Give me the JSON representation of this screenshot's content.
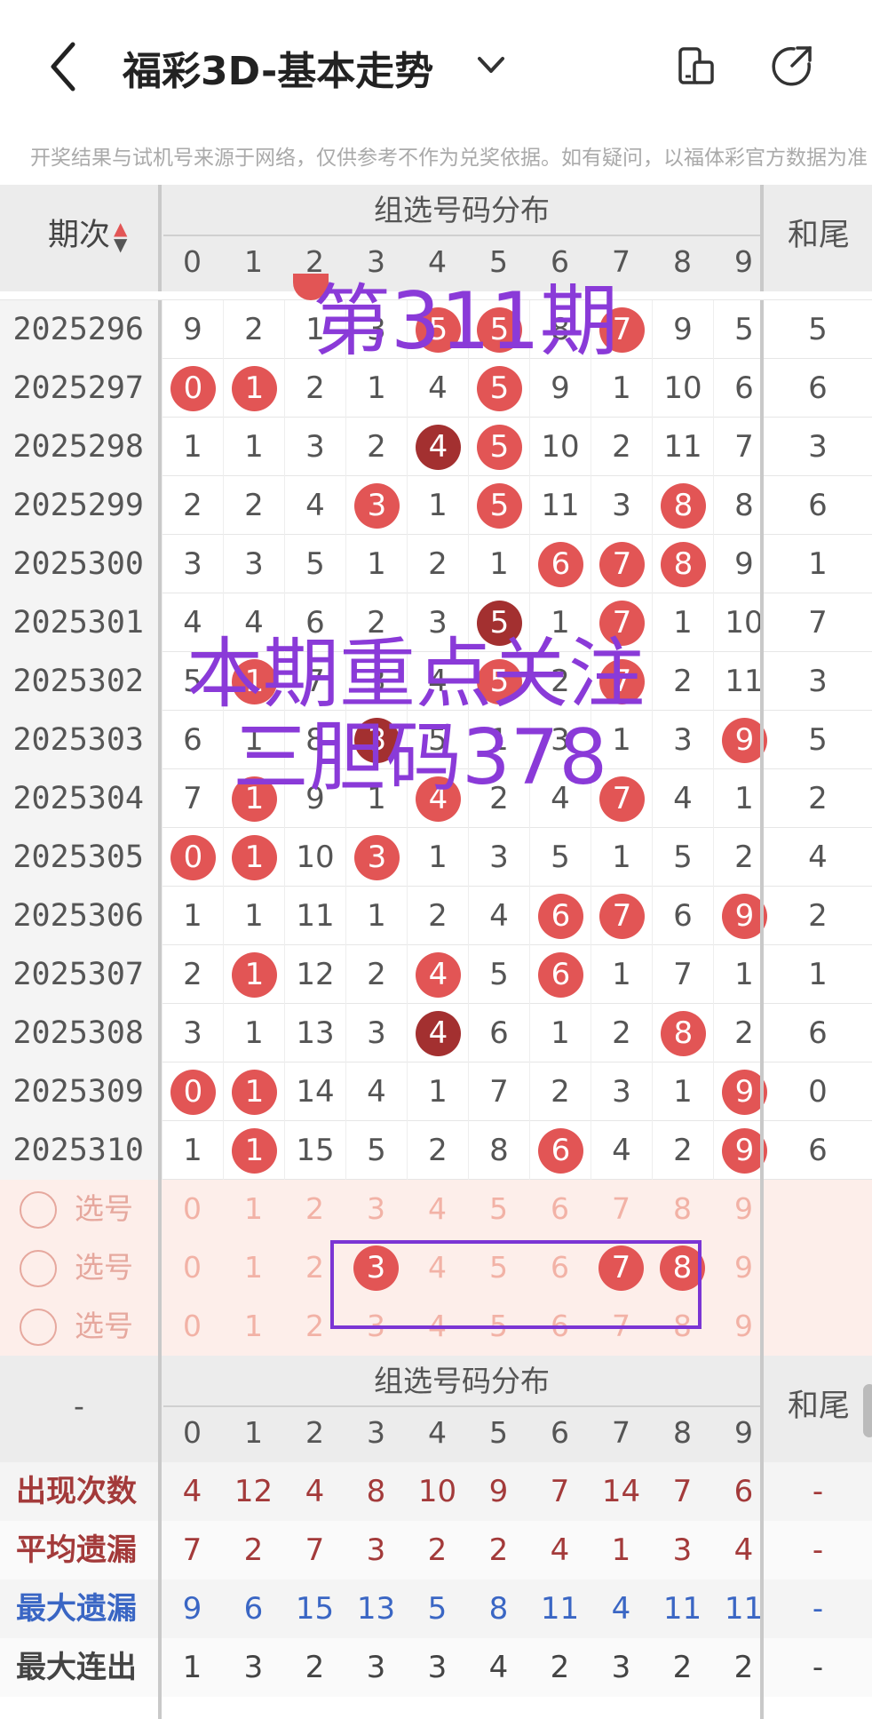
{
  "header": {
    "title": "福彩3D-基本走势",
    "back_icon": "chevron-left-icon",
    "dropdown_icon": "chevron-down-icon",
    "split_icon": "split-screen-icon",
    "share_icon": "share-icon"
  },
  "notice": "开奖结果与试机号来源于网络，仅供参考不作为兑奖依据。如有疑问，以福体彩官方数据为准",
  "table": {
    "period_header": "期次",
    "group_header": "组选号码分布",
    "tail_header": "和尾",
    "digits": [
      "0",
      "1",
      "2",
      "3",
      "4",
      "5",
      "6",
      "7",
      "8",
      "9"
    ],
    "rows": [
      {
        "period": "2025296",
        "cells": [
          "9",
          "2",
          "1",
          "3",
          "5",
          "5",
          "8",
          "7",
          "9",
          "5"
        ],
        "balls": [
          4,
          5,
          7
        ],
        "dark": [],
        "tail": "5"
      },
      {
        "period": "2025297",
        "cells": [
          "0",
          "1",
          "2",
          "1",
          "4",
          "5",
          "9",
          "1",
          "10",
          "6"
        ],
        "balls": [
          0,
          1,
          5
        ],
        "dark": [],
        "tail": "6"
      },
      {
        "period": "2025298",
        "cells": [
          "1",
          "1",
          "3",
          "2",
          "4",
          "5",
          "10",
          "2",
          "11",
          "7"
        ],
        "balls": [
          4,
          5
        ],
        "dark": [
          4
        ],
        "tail": "3"
      },
      {
        "period": "2025299",
        "cells": [
          "2",
          "2",
          "4",
          "3",
          "1",
          "5",
          "11",
          "3",
          "8",
          "8"
        ],
        "balls": [
          3,
          5,
          8
        ],
        "dark": [],
        "tail": "6"
      },
      {
        "period": "2025300",
        "cells": [
          "3",
          "3",
          "5",
          "1",
          "2",
          "1",
          "6",
          "7",
          "8",
          "9"
        ],
        "balls": [
          6,
          7,
          8
        ],
        "dark": [],
        "tail": "1"
      },
      {
        "period": "2025301",
        "cells": [
          "4",
          "4",
          "6",
          "2",
          "3",
          "5",
          "1",
          "7",
          "1",
          "10"
        ],
        "balls": [
          5,
          7
        ],
        "dark": [
          5
        ],
        "tail": "7"
      },
      {
        "period": "2025302",
        "cells": [
          "5",
          "1",
          "7",
          "3",
          "4",
          "5",
          "2",
          "7",
          "2",
          "11"
        ],
        "balls": [
          1,
          5,
          7
        ],
        "dark": [],
        "tail": "3"
      },
      {
        "period": "2025303",
        "cells": [
          "6",
          "1",
          "8",
          "3",
          "5",
          "1",
          "3",
          "1",
          "3",
          "9"
        ],
        "balls": [
          3,
          9
        ],
        "dark": [
          3
        ],
        "tail": "5"
      },
      {
        "period": "2025304",
        "cells": [
          "7",
          "1",
          "9",
          "1",
          "4",
          "2",
          "4",
          "7",
          "4",
          "1"
        ],
        "balls": [
          1,
          4,
          7
        ],
        "dark": [],
        "tail": "2"
      },
      {
        "period": "2025305",
        "cells": [
          "0",
          "1",
          "10",
          "3",
          "1",
          "3",
          "5",
          "1",
          "5",
          "2"
        ],
        "balls": [
          0,
          1,
          3
        ],
        "dark": [],
        "tail": "4"
      },
      {
        "period": "2025306",
        "cells": [
          "1",
          "1",
          "11",
          "1",
          "2",
          "4",
          "6",
          "7",
          "6",
          "9"
        ],
        "balls": [
          6,
          7,
          9
        ],
        "dark": [],
        "tail": "2"
      },
      {
        "period": "2025307",
        "cells": [
          "2",
          "1",
          "12",
          "2",
          "4",
          "5",
          "6",
          "1",
          "7",
          "1"
        ],
        "balls": [
          1,
          4,
          6
        ],
        "dark": [],
        "tail": "1"
      },
      {
        "period": "2025308",
        "cells": [
          "3",
          "1",
          "13",
          "3",
          "4",
          "6",
          "1",
          "2",
          "8",
          "2"
        ],
        "balls": [
          4,
          8
        ],
        "dark": [
          4
        ],
        "tail": "6"
      },
      {
        "period": "2025309",
        "cells": [
          "0",
          "1",
          "14",
          "4",
          "1",
          "7",
          "2",
          "3",
          "1",
          "9"
        ],
        "balls": [
          0,
          1,
          9
        ],
        "dark": [],
        "tail": "0"
      },
      {
        "period": "2025310",
        "cells": [
          "1",
          "1",
          "15",
          "5",
          "2",
          "8",
          "6",
          "4",
          "2",
          "9"
        ],
        "balls": [
          1,
          6,
          9
        ],
        "dark": [],
        "tail": "6"
      }
    ],
    "select_label": "选号",
    "select_rows": [
      {
        "selected": []
      },
      {
        "selected": [
          3,
          7,
          8
        ]
      },
      {
        "selected": []
      }
    ],
    "footer_dash": "-",
    "stats": [
      {
        "label": "出现次数",
        "values": [
          "4",
          "12",
          "4",
          "8",
          "10",
          "9",
          "7",
          "14",
          "7",
          "6"
        ],
        "tail": "-",
        "color": "#a33a3a"
      },
      {
        "label": "平均遗漏",
        "values": [
          "7",
          "2",
          "7",
          "3",
          "2",
          "2",
          "4",
          "1",
          "3",
          "4"
        ],
        "tail": "-",
        "color": "#a33a3a"
      },
      {
        "label": "最大遗漏",
        "values": [
          "9",
          "6",
          "15",
          "13",
          "5",
          "8",
          "11",
          "4",
          "11",
          "11"
        ],
        "tail": "-",
        "color": "#3a66c4"
      },
      {
        "label": "最大连出",
        "values": [
          "1",
          "3",
          "2",
          "3",
          "3",
          "4",
          "2",
          "3",
          "2",
          "2"
        ],
        "tail": "-",
        "color": "#444444"
      }
    ]
  },
  "overlays": {
    "issue": "第311期",
    "focus": "本期重点关注",
    "dan": "三胆码378"
  },
  "colors": {
    "ball": "#e25555",
    "ball_dark": "#a33030",
    "overlay": "#8a3ad8",
    "select_bg": "#fdeeea"
  }
}
